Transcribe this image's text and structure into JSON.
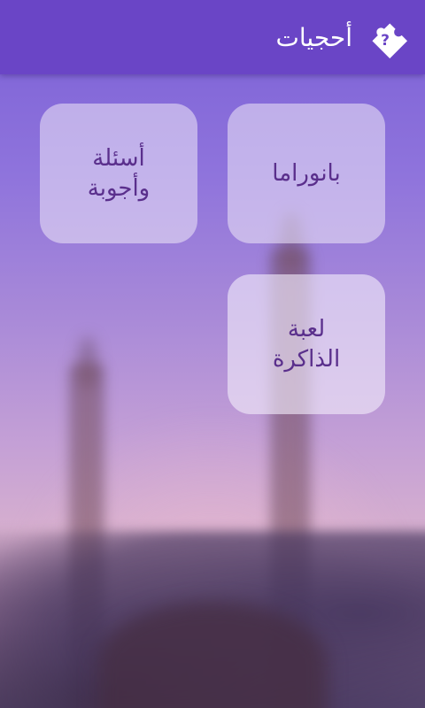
{
  "app": {
    "title": "أحجيات",
    "icon": "puzzle-question-icon"
  },
  "colors": {
    "action_bar": "#6a45c6",
    "tile_text": "#5a2f8c",
    "title_text": "#ffffff"
  },
  "menu": {
    "tiles": [
      {
        "id": "panorama",
        "label": "بانوراما"
      },
      {
        "id": "questions_answers",
        "label": "أسئلة\nوأجوبة"
      },
      {
        "id": "memory_game",
        "label": "لعبة\nالذاكرة"
      }
    ]
  }
}
